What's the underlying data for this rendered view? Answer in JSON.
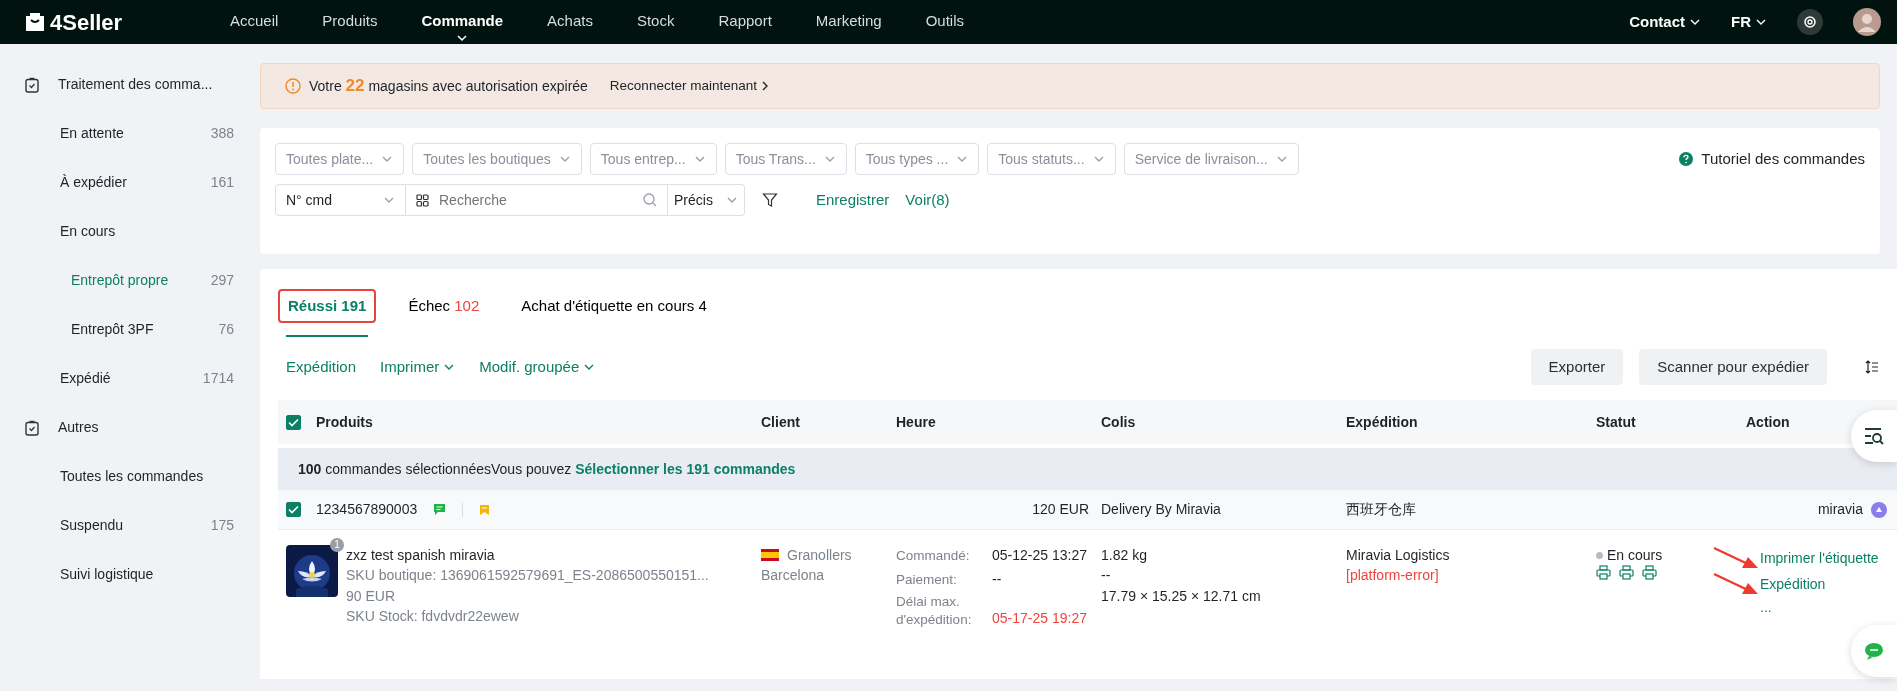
{
  "topbar": {
    "logo": "4Seller",
    "menu": [
      {
        "label": "Accueil",
        "selected": false
      },
      {
        "label": "Produits",
        "selected": false
      },
      {
        "label": "Commande",
        "selected": true
      },
      {
        "label": "Achats",
        "selected": false
      },
      {
        "label": "Stock",
        "selected": false
      },
      {
        "label": "Rapport",
        "selected": false
      },
      {
        "label": "Marketing",
        "selected": false
      },
      {
        "label": "Outils",
        "selected": false
      }
    ],
    "contact": "Contact",
    "language": "FR"
  },
  "sidebar": {
    "groups": [
      {
        "label": "Traitement des comma...",
        "items": [
          {
            "label": "En attente",
            "count": "388",
            "selected": false
          },
          {
            "label": "À expédier",
            "count": "161",
            "selected": false
          },
          {
            "label": "En cours",
            "selected": false,
            "children": [
              {
                "label": "Entrepôt propre",
                "count": "297",
                "selected": true
              },
              {
                "label": "Entrepôt 3PF",
                "count": "76",
                "selected": false
              }
            ]
          },
          {
            "label": "Expédié",
            "count": "1714",
            "selected": false
          }
        ]
      },
      {
        "label": "Autres",
        "items": [
          {
            "label": "Toutes les commandes",
            "selected": false
          },
          {
            "label": "Suspendu",
            "count": "175",
            "selected": false
          },
          {
            "label": "Suivi logistique",
            "selected": false
          }
        ]
      }
    ]
  },
  "alert": {
    "prefix": "Votre",
    "count": "22",
    "message": "magasins avec autorisation expirée",
    "link": "Reconnecter maintenant"
  },
  "filters": {
    "selects": [
      "Toutes plate...",
      "Toutes les boutiques",
      "Tous entrep...",
      "Tous Trans...",
      "Tous types ...",
      "Tous statuts...",
      "Service de livraison..."
    ],
    "tutorial": "Tutoriel des commandes",
    "search_type": "N° cmd",
    "search_placeholder": "Recherche",
    "match_mode": "Précis",
    "save": "Enregistrer",
    "view": "Voir(8)"
  },
  "tabs": [
    {
      "label": "Réussi",
      "count": "191",
      "selected": true,
      "highlighted": true,
      "kind": "plain"
    },
    {
      "label": "Échec",
      "count": "102",
      "selected": false,
      "highlighted": false,
      "kind": "error"
    },
    {
      "label": "Achat d'étiquette en cours",
      "count": "4",
      "selected": false,
      "highlighted": false,
      "kind": "plain"
    }
  ],
  "toolbar": {
    "actions": [
      {
        "label": "Expédition",
        "dropdown": false
      },
      {
        "label": "Imprimer",
        "dropdown": true
      },
      {
        "label": "Modif. groupée",
        "dropdown": true
      }
    ],
    "buttons": [
      "Exporter",
      "Scanner pour expédier"
    ]
  },
  "table": {
    "all_checked": true,
    "columns": [
      "Produits",
      "Client",
      "Heure",
      "Colis",
      "Expédition",
      "Statut",
      "Action"
    ],
    "selection": {
      "text": "**100** commandes sélectionnéesVous pouvez",
      "link": "Sélectionner les 191 commandes"
    },
    "orders": [
      {
        "checked": true,
        "number": "1234567890003",
        "amount": "120 EUR",
        "delivery": "Delivery By Miravia",
        "warehouse": "西班牙仓库",
        "platform": "miravia",
        "product": {
          "quantity": "1",
          "title": "zxz test spanish miravia",
          "sku_shop": "SKU boutique: 1369061592579691_ES-2086500550151...",
          "price": "90 EUR",
          "sku_stock": "SKU Stock: fdvdvdr22ewew"
        },
        "client": {
          "city": "Granollers",
          "region": "Barcelona"
        },
        "times": [
          {
            "label": "Commandé:",
            "value": "05-12-25 13:27",
            "overdue": false
          },
          {
            "label": "Paiement:",
            "value": "--",
            "overdue": false
          },
          {
            "label": "Délai max. d'expédition:",
            "value": "05-17-25 19:27",
            "overdue": true
          }
        ],
        "package": {
          "weight": "1.82 kg",
          "line_2": "--",
          "dimensions": "17.79 × 15.25 × 12.71 cm"
        },
        "shipping": {
          "carrier": "Miravia Logistics",
          "error": "[platform-error]"
        },
        "status": {
          "label": "En cours"
        },
        "actions": [
          {
            "label": "Imprimer l'étiquette",
            "arrow": true
          },
          {
            "label": "Expédition",
            "arrow": true
          },
          {
            "label": "...",
            "arrow": false
          }
        ]
      }
    ]
  }
}
